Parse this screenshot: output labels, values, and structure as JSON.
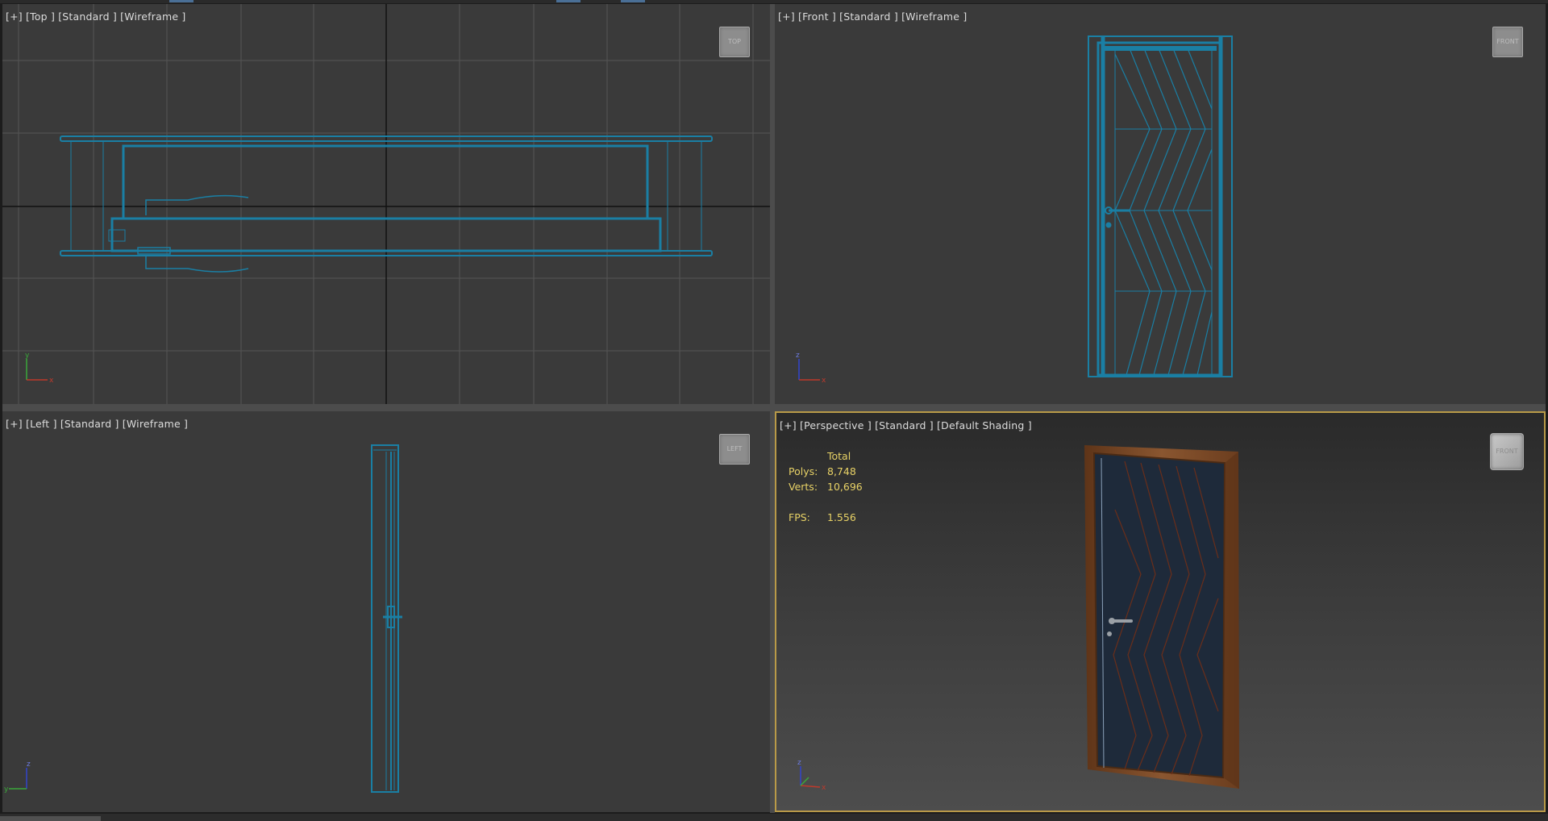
{
  "viewports": {
    "top": {
      "label": "[+] [Top ] [Standard ] [Wireframe ]",
      "cube": "TOP"
    },
    "front": {
      "label": "[+] [Front ] [Standard ] [Wireframe ]",
      "cube": "FRONT"
    },
    "left": {
      "label": "[+] [Left ] [Standard ] [Wireframe ]",
      "cube": "LEFT"
    },
    "perspective": {
      "label": "[+] [Perspective ] [Standard ] [Default Shading ]",
      "cube": "FRONT"
    }
  },
  "stats": {
    "header": "Total",
    "polys_label": "Polys:",
    "polys_value": "8,748",
    "verts_label": "Verts:",
    "verts_value": "10,696",
    "fps_label": "FPS:",
    "fps_value": "1.556"
  },
  "axes": {
    "top": [
      "y",
      "x"
    ],
    "front": [
      "z",
      "x"
    ],
    "left": [
      "z",
      "y"
    ],
    "perspective": [
      "z",
      "x"
    ]
  },
  "colors": {
    "wireframe": "#1a7fa4",
    "grid": "#575757",
    "active_border": "#b99a48",
    "stats_text": "#e8d266",
    "door_wood": "#7c4a26",
    "door_panel": "#1e2a3a"
  }
}
